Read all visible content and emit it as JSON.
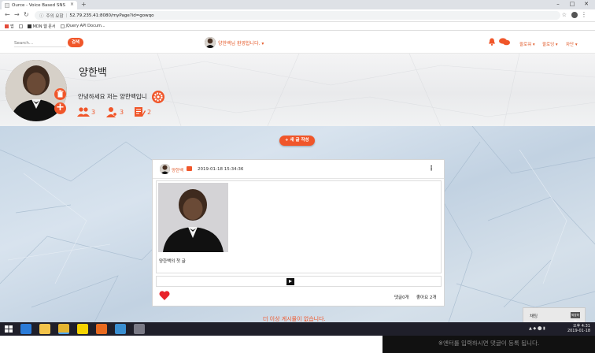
{
  "browser": {
    "tab_title": "Ource - Voice Based SNS",
    "tab_close": "×",
    "new_tab": "+",
    "security_label": "주의 요함",
    "url": "52.79.235.41:8080/myPage?id=gowqo",
    "bookmarks": [
      "앱",
      "MDN 웹 문서",
      "jQuery API Docum..."
    ]
  },
  "nav": {
    "search_placeholder": "Search...",
    "search_button": "검색",
    "welcome": "양한백님 환영합니다. ▾",
    "links": [
      "팔로워 ▾",
      "팔로잉 ▾",
      "차단 ▾"
    ]
  },
  "profile": {
    "name": "양한백",
    "bio": "안녕하세요 저는 양한백입니",
    "stats": [
      {
        "icon": "followers-icon",
        "value": "3"
      },
      {
        "icon": "following-icon",
        "value": "3"
      },
      {
        "icon": "posts-icon",
        "value": "2"
      }
    ]
  },
  "feed": {
    "new_post_button": "+ 새 글 작성",
    "no_more": "더 이상 게시물이 없습니다.",
    "post": {
      "author": "양한백",
      "timestamp": "2019-01-18 15:34:36",
      "text": "양한백의 첫 글",
      "comments": "댓글0개",
      "likes": "좋아요 2개"
    }
  },
  "chat_widget": {
    "title": "채팅",
    "button": "퇴장하기"
  },
  "comment_bar": {
    "placeholder": "※엔터를 입력하시면 댓글이 등록 됩니다."
  },
  "taskbar": {
    "time": "오후 4:31",
    "date": "2019-01-18"
  },
  "colors": {
    "accent": "#f0562a",
    "feed_bg": "#c8d7e5"
  }
}
